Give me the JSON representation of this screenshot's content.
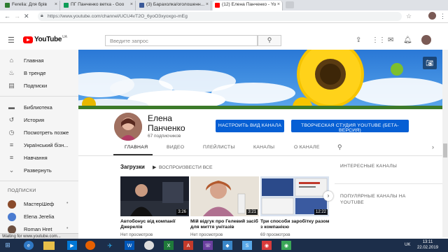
{
  "browser": {
    "tabs": [
      {
        "label": "Ferelia: Для брів",
        "color": "#2e7d32"
      },
      {
        "label": "ПГ Панченко ветка - Goo",
        "color": "#0f9d58"
      },
      {
        "label": "(3) Барахолка/оголошенн...",
        "color": "#3b5998"
      },
      {
        "label": "(12) Елена Панченко - Yo",
        "color": "#ff0000"
      }
    ],
    "url": "https://www.youtube.com/channel/UCU4vT2O_6yoO3xyoxgo-mEg"
  },
  "masthead": {
    "logo_text": "YouTube",
    "logo_region": "UA",
    "search_placeholder": "Введите запрос"
  },
  "sidebar": {
    "top": [
      {
        "label": "Главная",
        "icon": "home-icon"
      },
      {
        "label": "В тренде",
        "icon": "fire-icon"
      },
      {
        "label": "Подписки",
        "icon": "subscriptions-icon"
      }
    ],
    "library": [
      {
        "label": "Библиотека",
        "icon": "folder-icon"
      },
      {
        "label": "История",
        "icon": "history-icon"
      },
      {
        "label": "Посмотреть позже",
        "icon": "clock-icon"
      },
      {
        "label": "Український бізн...",
        "icon": "playlist-icon"
      },
      {
        "label": "Навчання",
        "icon": "playlist-icon"
      },
      {
        "label": "Развернуть",
        "icon": "chevron-down-icon"
      }
    ],
    "subs_header": "ПОДПИСКИ",
    "subs": [
      {
        "label": "МастерШеф",
        "color": "#8a4b2b",
        "dot": "•"
      },
      {
        "label": "Elena Jerelia",
        "color": "#4a7bd0",
        "dot": ""
      },
      {
        "label": "Roman Hret",
        "color": "#6d5040",
        "dot": "•"
      }
    ]
  },
  "channel": {
    "name": "Елена Панченко",
    "subscribers": "67 подписчиков",
    "customize_button": "НАСТРОИТЬ ВИД КАНАЛА",
    "studio_button": "ТВОРЧЕСКАЯ СТУДИЯ YOUTUBE (БЕТА-ВЕРСИЯ)",
    "tabs": [
      "ГЛАВНАЯ",
      "ВИДЕО",
      "ПЛЕЙЛИСТЫ",
      "КАНАЛЫ",
      "О КАНАЛЕ"
    ],
    "active_tab": "ГЛАВНАЯ"
  },
  "uploads": {
    "title": "Загрузки",
    "play_all": "ВОСПРОИЗВЕСТИ ВСЕ",
    "videos": [
      {
        "title": "Автобонус від компанії Джерелія",
        "duration": "3:26",
        "views": "Нет просмотров"
      },
      {
        "title": "Мій відгук про Гелевий засіб для миття унітазів",
        "duration": "3:21",
        "views": "Нет просмотров"
      },
      {
        "title": "Три способи заробітку разом з компанією",
        "duration": "12:22",
        "views": "69 просмотров"
      }
    ]
  },
  "right_column": {
    "interesting": "ИНТЕРЕСНЫЕ КАНАЛЫ",
    "popular": "ПОПУЛЯРНЫЕ КАНАЛЫ НА YOUTUBE"
  },
  "status_bar": "Waiting for www.youtube.com...",
  "taskbar": {
    "lang": "UK",
    "time": "13:11",
    "date": "22.02.2019"
  }
}
